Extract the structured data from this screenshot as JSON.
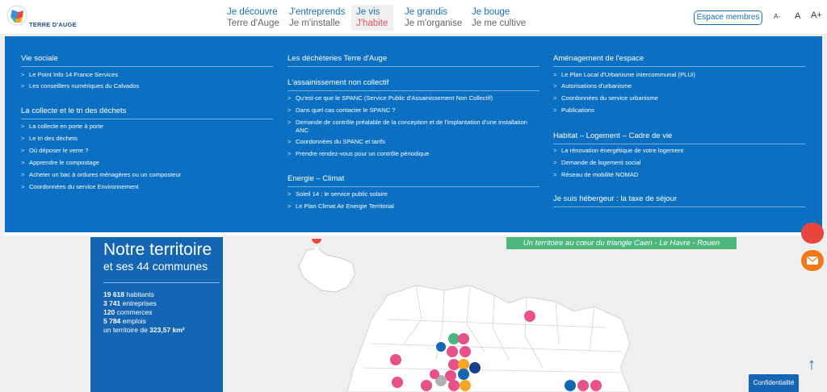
{
  "header": {
    "logo_text": "TERRE D'AUGE",
    "nav": [
      {
        "line1": "Je découvre",
        "line2": "Terre d'Auge"
      },
      {
        "line1": "J'entreprends",
        "line2": "Je m'installe"
      },
      {
        "line1": "Je vis",
        "line2": "J'habite"
      },
      {
        "line1": "Je grandis",
        "line2": "Je m'organise"
      },
      {
        "line1": "Je bouge",
        "line2": "Je me cultive"
      }
    ],
    "members_label": "Espace membres",
    "font_minus": "A-",
    "font_normal": "A",
    "font_plus": "A+"
  },
  "menu": {
    "col1": {
      "sections": [
        {
          "title": "Vie sociale",
          "links": [
            "Le Point Info 14 France Services",
            "Les conseillers numériques du Calvados"
          ]
        },
        {
          "title": "La collecte et le tri des déchets",
          "links": [
            "La collecte en porte à porte",
            "Le tri des déchets",
            "Où déposer le verre ?",
            "Apprendre le compostage",
            "Acheter un bac à ordures ménagères ou un composteur",
            "Coordonnées du service Environnement"
          ]
        }
      ]
    },
    "col2": {
      "sections": [
        {
          "title": "Les déchèteries Terre d'Auge",
          "links": []
        },
        {
          "title": "L'assainissement non collectif",
          "links": [
            "Qu'est-ce que le SPANC (Service Public d'Assainissement Non Collectif)",
            "Dans quel cas contacter le SPANC ?",
            "Demande de contrôle préalable de la conception et de l'implantation d'une installation ANC",
            "Coordonnées du SPANC et tarifs",
            "Prendre rendez-vous pour un contrôle périodique"
          ]
        },
        {
          "title": "Energie – Climat",
          "links": [
            "Soleil 14 : le service public solaire",
            "Le Plan Climat Air Energie Territorial"
          ]
        }
      ]
    },
    "col3": {
      "sections": [
        {
          "title": "Aménagement de l'espace",
          "links": [
            "Le Plan Local d'Urbanisme intercommunal (PLUi)",
            "Autorisations d'urbanisme",
            "Coordonnées du service urbanisme",
            "Publications"
          ]
        },
        {
          "title": "Habitat – Logement – Cadre de vie",
          "links": [
            "La rénovation énergétique de votre logement",
            "Demande de logement social",
            "Réseau de mobilité NOMAD"
          ]
        },
        {
          "title": "Je suis hébergeur : la taxe de séjour",
          "links": []
        }
      ]
    }
  },
  "territory": {
    "title": "Notre territoire",
    "subtitle": "et ses 44 communes",
    "stats": [
      {
        "value": "19 618",
        "label": " habitants"
      },
      {
        "value": "3 741",
        "label": " entreprises"
      },
      {
        "value": "120",
        "label": " commerces"
      },
      {
        "value": "5 784",
        "label": " emplois"
      },
      {
        "value": "323,57 km²",
        "label": "un territoire de "
      }
    ]
  },
  "tagline": "Un territoire au cœur du triangle Caen - Le Havre - Rouen",
  "confidentiality_label": "Confidentialité",
  "colors": {
    "accent": "#0b6fc2",
    "active": "#e8506b",
    "green": "#4cb77d"
  }
}
